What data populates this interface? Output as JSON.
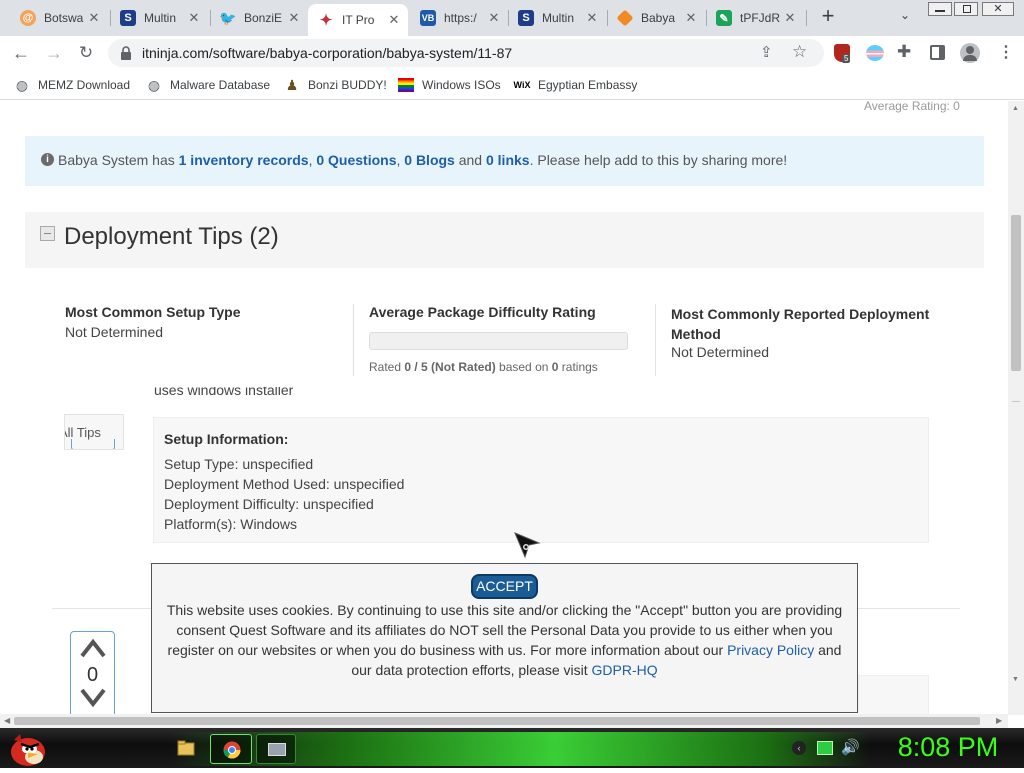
{
  "tabs": [
    {
      "label": "Botswa",
      "favicon": "orange-swirl-icon",
      "active": false
    },
    {
      "label": "Multin",
      "favicon": "s-logo-icon",
      "active": false
    },
    {
      "label": "BonziE",
      "favicon": "twitter-bird-icon",
      "active": false
    },
    {
      "label": "IT Pro",
      "favicon": "itninja-star-icon",
      "active": true
    },
    {
      "label": "https:/",
      "favicon": "vb-logo-icon",
      "active": false
    },
    {
      "label": "Multin",
      "favicon": "s-logo-icon",
      "active": false
    },
    {
      "label": "Babya",
      "favicon": "orange-diamond-icon",
      "active": false
    },
    {
      "label": "tPFJdR",
      "favicon": "green-square-icon",
      "active": false
    }
  ],
  "toolbar": {
    "url": "itninja.com/software/babya-corporation/babya-system/11-87",
    "extension_badge": "5"
  },
  "bookmarks": [
    {
      "label": "MEMZ Download",
      "icon": "globe-icon"
    },
    {
      "label": "Malware Database",
      "icon": "globe-icon"
    },
    {
      "label": "Bonzi BUDDY!",
      "icon": "bonzi-icon"
    },
    {
      "label": "Windows ISOs",
      "icon": "rainbow-flag-icon"
    },
    {
      "label": "Egyptian Embassy",
      "icon": "wix-icon"
    }
  ],
  "page": {
    "average_rating": "Average Rating: 0",
    "info": {
      "prefix": "Babya System has ",
      "inventory": "1 inventory records",
      "sep1": ", ",
      "questions": "0 Questions",
      "sep2": ", ",
      "blogs": "0 Blogs",
      "and": " and ",
      "links": "0 links",
      "suffix": ". Please help add to this by sharing more!"
    },
    "deployment_title": "Deployment Tips (2)",
    "stats": {
      "setup_type_label": "Most Common Setup Type",
      "setup_type_value": "Not Determined",
      "difficulty_label": "Average Package Difficulty Rating",
      "rated_prefix": "Rated ",
      "rated_value": "0 / 5 (Not Rated)",
      "rated_mid": " based on ",
      "rated_count": "0",
      "rated_suffix": " ratings",
      "method_label": "Most Commonly Reported Deployment Method",
      "method_value": "Not Determined"
    },
    "partial_text": "uses windows installer",
    "all_tips_tab": "All Tips",
    "setup_info": {
      "title": "Setup Information:",
      "lines": [
        "Setup Type: unspecified",
        "Deployment Method Used: unspecified",
        "Deployment Difficulty: unspecified",
        "Platform(s): Windows"
      ]
    },
    "vote_count": "0"
  },
  "cookie": {
    "accept": "ACCEPT",
    "text": "This website uses cookies. By continuing to use this site and/or clicking the \"Accept\" button you are providing consent Quest Software and its affiliates do NOT sell the Personal Data you provide to us either when you register on our websites or when you do business with us. For more information about our ",
    "privacy": "Privacy Policy",
    "middle": " and our data protection efforts, please visit ",
    "gdpr": "GDPR-HQ"
  },
  "taskbar": {
    "clock": "8:08 PM"
  },
  "colors": {
    "info_bg": "#e8f4fc",
    "link": "#1f5ea8",
    "accept_bg": "#1a5c96",
    "clock": "#39ff14"
  }
}
